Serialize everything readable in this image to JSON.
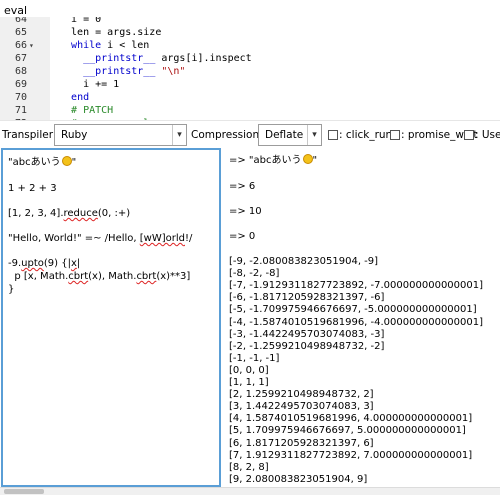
{
  "eval_bar": {
    "label": "eval"
  },
  "editor": {
    "lines": [
      {
        "num": "64",
        "fold": "",
        "segs": [
          {
            "t": "  i = 0",
            "c": "op"
          }
        ]
      },
      {
        "num": "65",
        "fold": "",
        "segs": [
          {
            "t": "  len = args.size",
            "c": "op"
          }
        ]
      },
      {
        "num": "66",
        "fold": "▾",
        "segs": [
          {
            "t": "  ",
            "c": "op"
          },
          {
            "t": "while",
            "c": "kw"
          },
          {
            "t": " i < len",
            "c": "op"
          }
        ]
      },
      {
        "num": "67",
        "fold": "",
        "segs": [
          {
            "t": "    ",
            "c": "op"
          },
          {
            "t": "__printstr__",
            "c": "bi"
          },
          {
            "t": " args[i].inspect",
            "c": "op"
          }
        ]
      },
      {
        "num": "68",
        "fold": "",
        "segs": [
          {
            "t": "    ",
            "c": "op"
          },
          {
            "t": "__printstr__",
            "c": "bi"
          },
          {
            "t": " ",
            "c": "op"
          },
          {
            "t": "\"\\n\"",
            "c": "str"
          }
        ]
      },
      {
        "num": "69",
        "fold": "",
        "segs": [
          {
            "t": "    i += 1",
            "c": "op"
          }
        ]
      },
      {
        "num": "70",
        "fold": "",
        "segs": [
          {
            "t": "  ",
            "c": "op"
          },
          {
            "t": "end",
            "c": "kw"
          }
        ]
      },
      {
        "num": "71",
        "fold": "",
        "segs": [
          {
            "t": "  ",
            "c": "op"
          },
          {
            "t": "# PATCH",
            "c": "cmt"
          }
        ]
      },
      {
        "num": "72",
        "fold": "",
        "segs": [
          {
            "t": "  ",
            "c": "op"
          },
          {
            "t": "# args.__svalue",
            "c": "cmt"
          }
        ]
      }
    ]
  },
  "toolbar": {
    "transpiler_label": "Transpiler:",
    "transpiler_value": "Ruby",
    "compression_label": "Compression:",
    "compression_value": "Deflate",
    "checkboxes": [
      {
        "label": ": click_run"
      },
      {
        "label": ": promise_wait"
      },
      {
        "label": ": Use w"
      }
    ]
  },
  "input": {
    "lines": [
      {
        "segs": [
          {
            "t": "\"abcあいう",
            "sq": false
          },
          {
            "t": "\"",
            "sq": false
          }
        ],
        "smile_after_index": 0
      },
      {
        "segs": [
          {
            "t": "1 + 2 + 3",
            "sq": false
          }
        ]
      },
      {
        "segs": [
          {
            "t": "[1, 2, 3, 4].",
            "sq": false
          },
          {
            "t": "reduce",
            "sq": true
          },
          {
            "t": "(0, :+)",
            "sq": false
          }
        ]
      },
      {
        "segs": [
          {
            "t": "\"Hello, World!\" =~ /Hello, ",
            "sq": false
          },
          {
            "t": "[wW]orld",
            "sq": true
          },
          {
            "t": "!/",
            "sq": false
          }
        ]
      },
      {
        "segs": [
          {
            "t": "-9.",
            "sq": false
          },
          {
            "t": "upto",
            "sq": true
          },
          {
            "t": "(9) {|",
            "sq": false
          },
          {
            "t": "x",
            "sq": true
          },
          {
            "t": "|",
            "sq": false
          }
        ]
      },
      {
        "segs": [
          {
            "t": "  p [x, Math.",
            "sq": false
          },
          {
            "t": "cbrt",
            "sq": true
          },
          {
            "t": "(x), Math.",
            "sq": false
          },
          {
            "t": "cbrt",
            "sq": true
          },
          {
            "t": "(x)**3]",
            "sq": false
          }
        ]
      },
      {
        "segs": [
          {
            "t": "}",
            "sq": false
          }
        ]
      }
    ]
  },
  "output": {
    "results": [
      {
        "text": "=> \"abcあいう",
        "smile": true,
        "tail": "\""
      },
      {
        "text": "=> 6"
      },
      {
        "text": "=> 10"
      },
      {
        "text": "=> 0"
      }
    ],
    "rows": [
      "[-9, -2.080083823051904, -9]",
      "[-8, -2, -8]",
      "[-7, -1.9129311827723892, -7.000000000000001]",
      "[-6, -1.8171205928321397, -6]",
      "[-5, -1.709975946676697, -5.000000000000001]",
      "[-4, -1.5874010519681996, -4.000000000000001]",
      "[-3, -1.4422495703074083, -3]",
      "[-2, -1.2599210498948732, -2]",
      "[-1, -1, -1]",
      "[0, 0, 0]",
      "[1, 1, 1]",
      "[2, 1.2599210498948732, 2]",
      "[3, 1.4422495703074083, 3]",
      "[4, 1.5874010519681996, 4.000000000000001]",
      "[5, 1.709975946676697, 5.000000000000001]",
      "[6, 1.8171205928321397, 6]",
      "[7, 1.9129311827723892, 7.000000000000001]",
      "[8, 2, 8]",
      "[9, 2.080083823051904, 9]"
    ]
  }
}
